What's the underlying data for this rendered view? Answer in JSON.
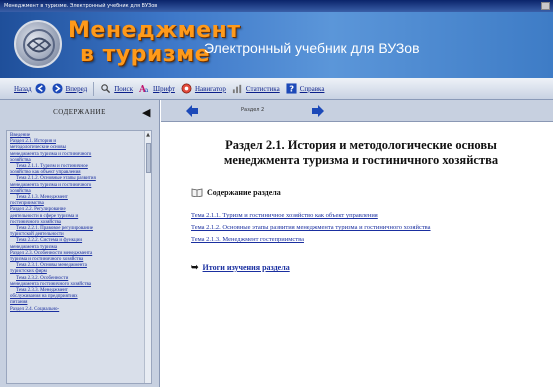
{
  "window": {
    "title": "Менеджмент в туризме. Электронный учебник для ВУЗов"
  },
  "banner": {
    "brand_line1": "Менеджмент",
    "brand_line2": "в туризме",
    "subtitle": "Электронный учебник для ВУЗов"
  },
  "toolbar": {
    "items": [
      {
        "label": "Назад",
        "icon": "arrow-left-icon"
      },
      {
        "label": "Вперед",
        "icon": "arrow-right-icon"
      },
      {
        "label": "Поиск",
        "icon": "search-icon"
      },
      {
        "label": "Шрифт",
        "icon": "font-icon"
      },
      {
        "label": "Навигатор",
        "icon": "navigator-icon"
      },
      {
        "label": "Статистика",
        "icon": "statistics-icon"
      },
      {
        "label": "Справка",
        "icon": "help-icon"
      }
    ]
  },
  "sidebar": {
    "header": "СОДЕРЖАНИЕ",
    "items": [
      "Введение",
      "Раздел 2.1. История и",
      "методологические основы",
      "менеджмента туризма и гостиничного",
      "хозяйства",
      "Тема 2.1.1. Туризм и гостиничное",
      "хозяйство как объект управления",
      "Тема 2.1.2. Основные этапы развития",
      "менеджмента туризма и гостиничного",
      "хозяйства",
      "Тема 2.1.3. Менеджмент",
      "гостеприимства",
      "Раздел 2.2. Регулирование",
      "деятельности в сфере туризма и",
      "гостиничного хозяйства",
      "Тема 2.2.1. Правовое регулирование",
      "туристской деятельности",
      "Тема 2.2.2. Система и функции",
      "менеджмента туризма",
      "Раздел 2.3. Особенности менеджмента",
      "туризма и гостиничного хозяйства",
      "Тема 2.3.1. Основы менеджмента",
      "туристских фирм",
      "Тема 2.3.2. Особенности",
      "менеджмента гостиничного хозяйства",
      "Тема 2.3.3. Менеджмент",
      "обслуживания на предприятиях",
      "питания",
      "Раздел 2.4. Социально-"
    ]
  },
  "main": {
    "nav_label": "Раздел 2",
    "heading_line1": "Раздел 2.1. История и методологические основы",
    "heading_line2": "менеджмента туризма и гостиничного хозяйства",
    "toc_title": "Содержание раздела",
    "topics": [
      "Тема 2.1.1. Туризм и гостиничное хозяйство как объект управления",
      "Тема 2.1.2. Основные этапы развития менеджмента туризма и гостиничного хозяйства",
      "Тема 2.1.3. Менеджмент гостеприимства"
    ],
    "results_link": "Итоги изучения раздела"
  }
}
